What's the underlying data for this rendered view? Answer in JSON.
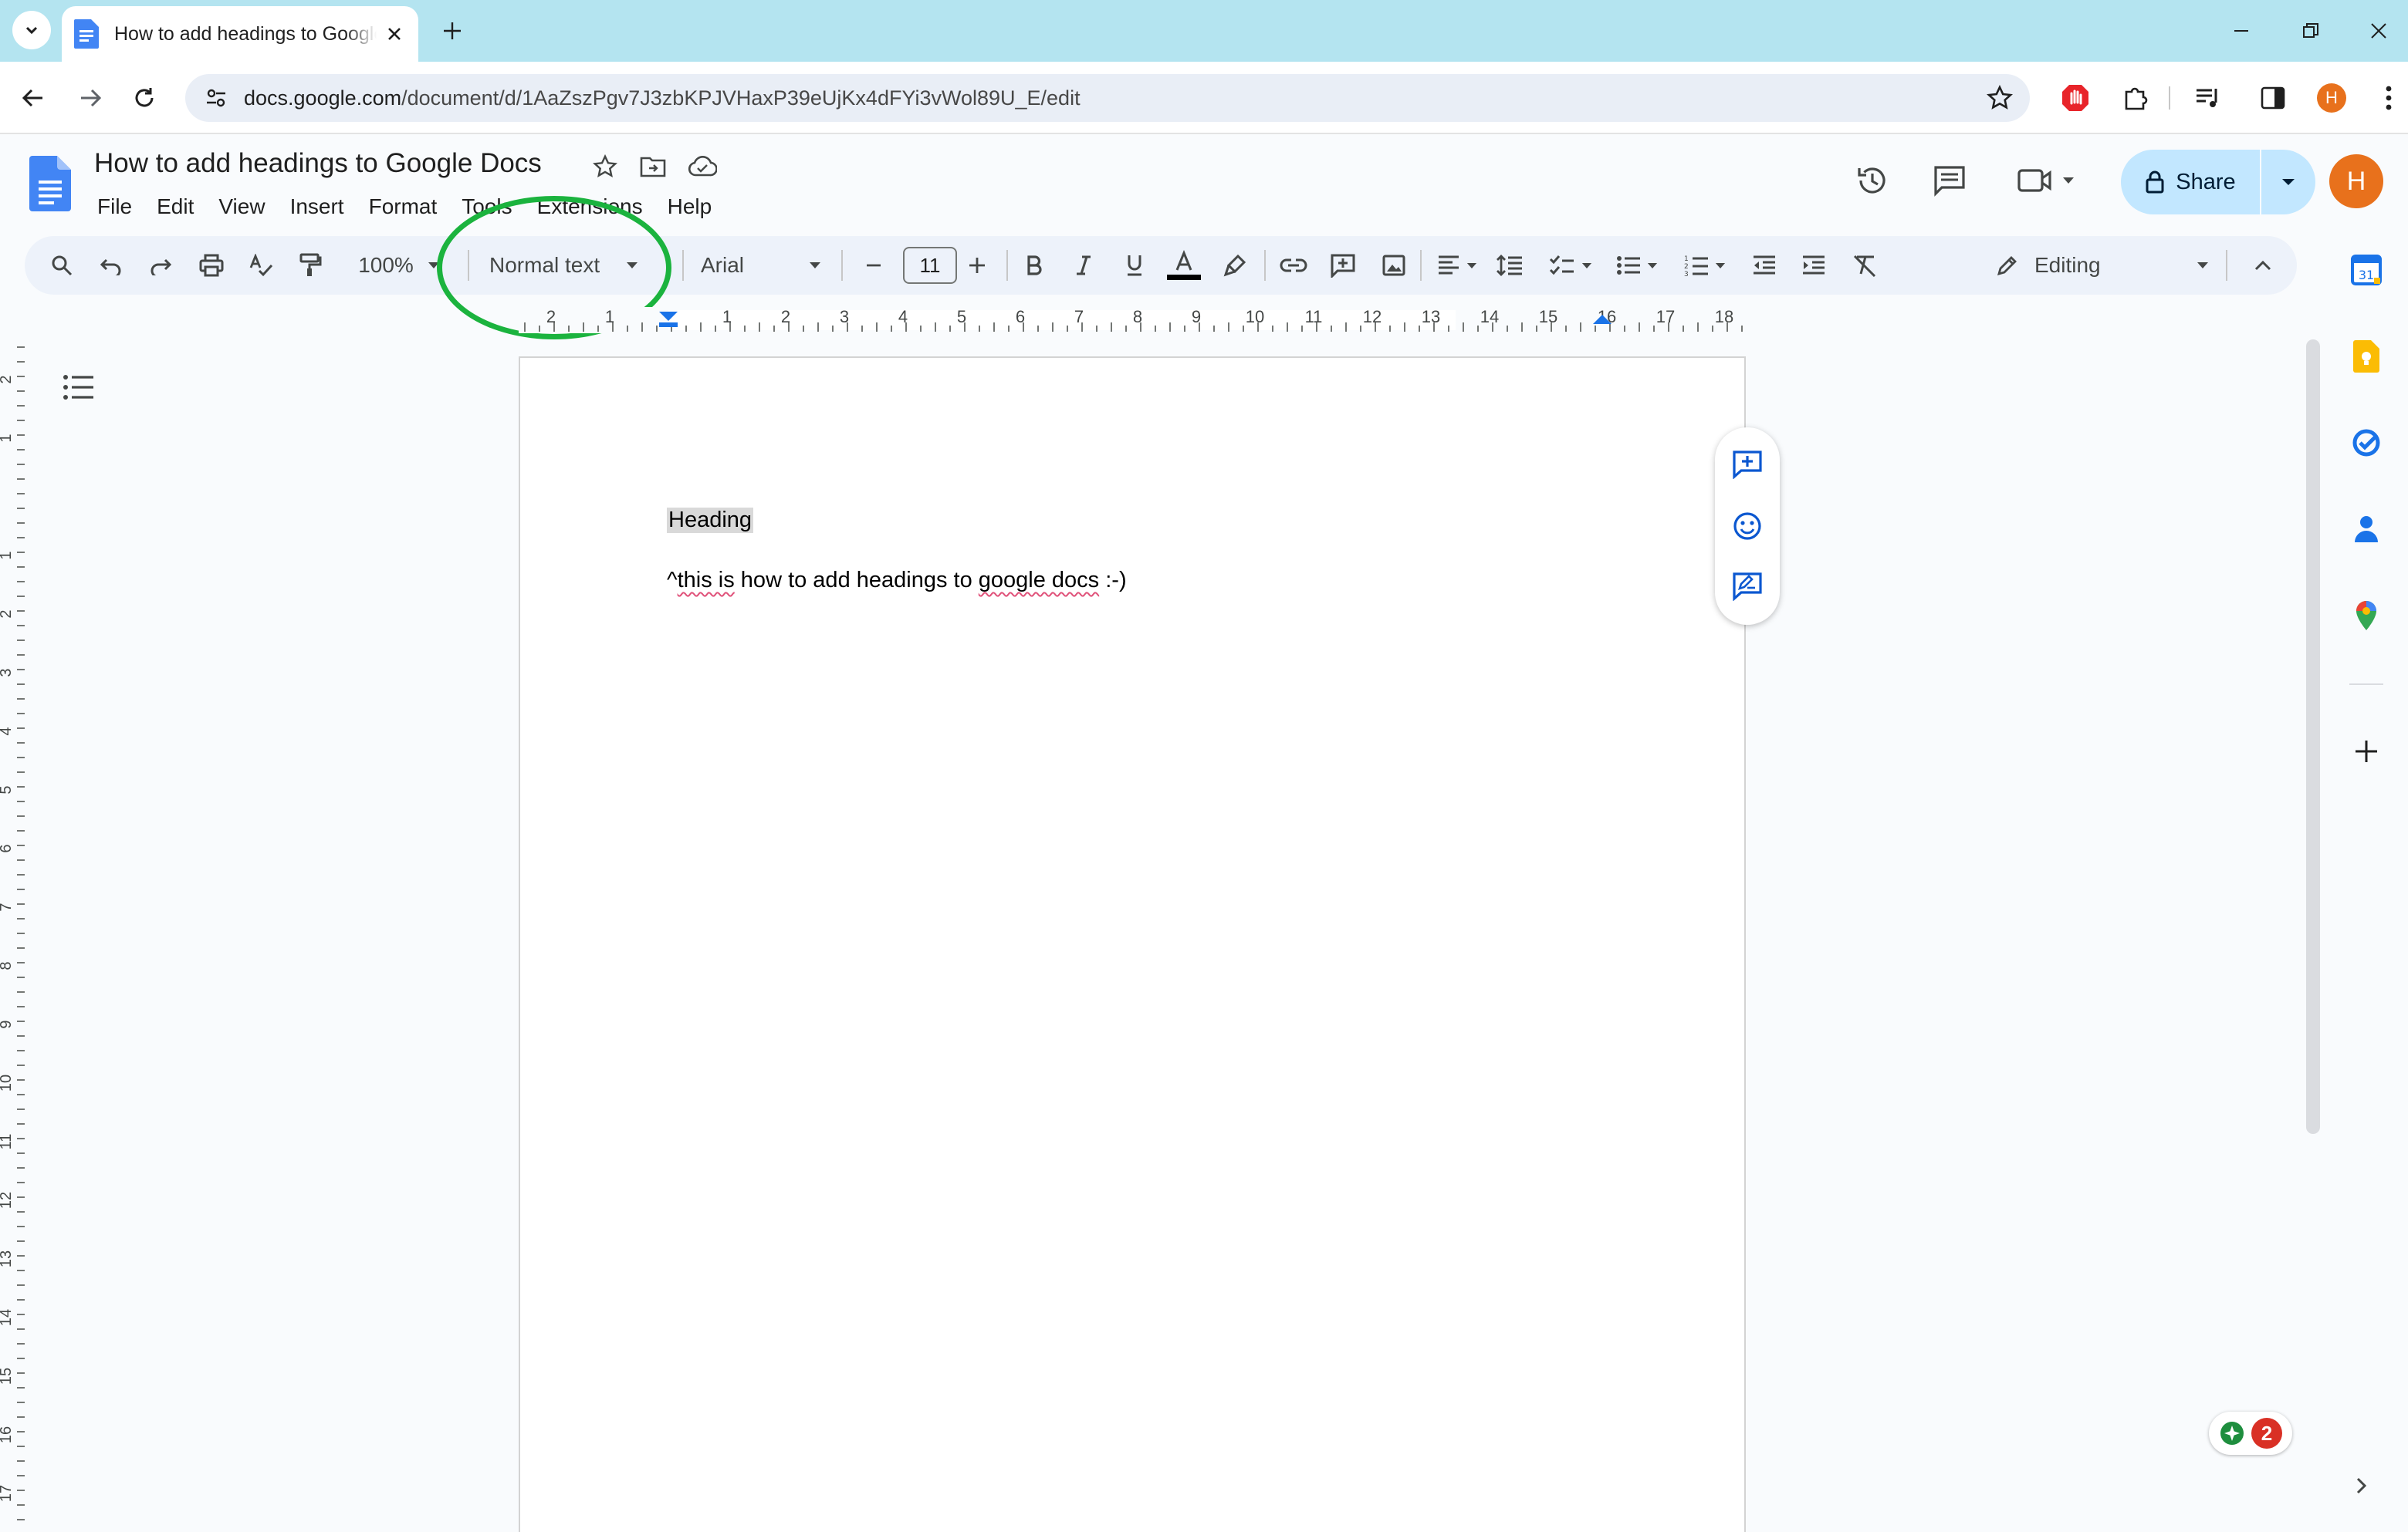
{
  "browser": {
    "tab_title": "How to add headings to Google Docs",
    "url_host": "docs.google.com",
    "url_path": "/document/d/1AaZszPgv7J3zbKPJVHaxP39eUjKx4dFYi3vWol89U_E/edit",
    "profile_initial": "H"
  },
  "header": {
    "doc_title": "How to add headings to Google Docs",
    "menu": [
      "File",
      "Edit",
      "View",
      "Insert",
      "Format",
      "Tools",
      "Extensions",
      "Help"
    ],
    "share_label": "Share",
    "avatar_initial": "H"
  },
  "toolbar": {
    "zoom": "100%",
    "paragraph_style": "Normal text",
    "font": "Arial",
    "font_size": "11",
    "mode": "Editing"
  },
  "ruler": {
    "labels": [
      "2",
      "1",
      "",
      "1",
      "2",
      "3",
      "4",
      "5",
      "6",
      "7",
      "8",
      "9",
      "10",
      "11",
      "12",
      "13",
      "14",
      "15",
      "16",
      "17",
      "18"
    ]
  },
  "vruler": {
    "labels": [
      "2",
      "1",
      "",
      "1",
      "2",
      "3",
      "4",
      "5",
      "6",
      "7",
      "8",
      "9",
      "10",
      "11",
      "12",
      "13",
      "14",
      "15",
      "16",
      "17"
    ]
  },
  "document": {
    "heading": "Heading",
    "body_prefix": "^",
    "body_w1": "this is",
    "body_mid": " how to add headings to ",
    "body_w2": "google docs",
    "body_suffix": " :-)"
  },
  "explore": {
    "count": "2"
  },
  "colors": {
    "accent": "#0b57d0",
    "share_bg": "#c2e7ff",
    "annotation": "#1bb33e",
    "avatar": "#e8711c"
  }
}
